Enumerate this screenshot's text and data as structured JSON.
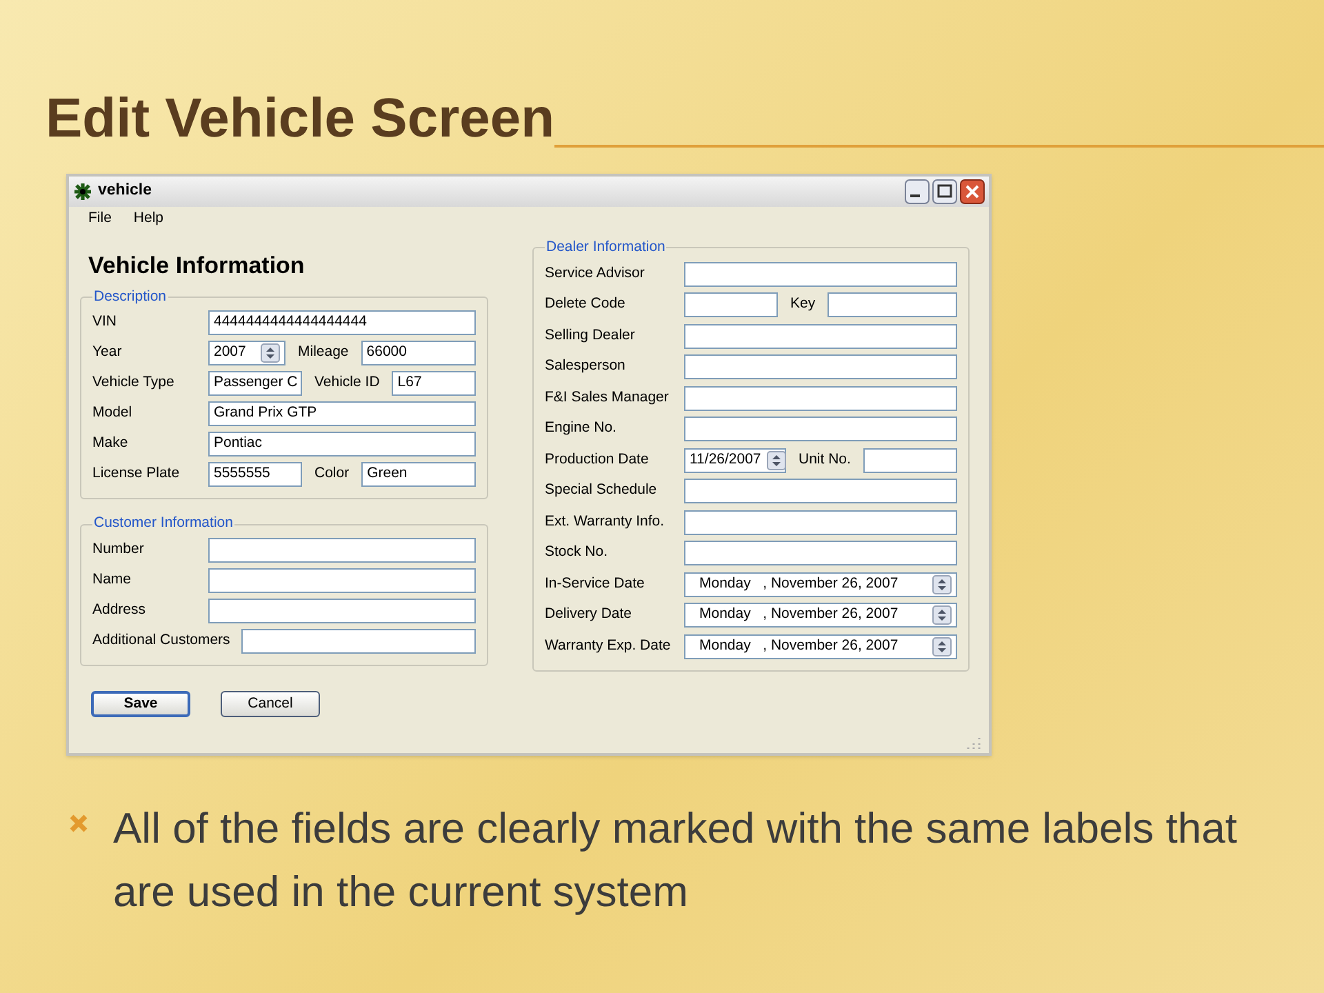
{
  "slide": {
    "title": "Edit Vehicle Screen",
    "bullets": [
      "All of the fields are clearly marked with the same labels that are used in the current system"
    ]
  },
  "window": {
    "title": "vehicle",
    "menu": [
      "File",
      "Help"
    ],
    "heading": "Vehicle Information",
    "description": {
      "legend": "Description",
      "rows": [
        {
          "label": "VIN",
          "inputs": [
            {
              "kind": "text",
              "value": "4444444444444444444"
            }
          ]
        },
        {
          "label": "Year",
          "inputs": [
            {
              "kind": "spinner",
              "value": "2007"
            },
            {
              "kind": "text",
              "label": "Mileage",
              "value": "66000"
            }
          ]
        },
        {
          "label": "Vehicle Type",
          "inputs": [
            {
              "kind": "text",
              "value": "Passenger C"
            },
            {
              "kind": "text",
              "label": "Vehicle ID",
              "value": "L67"
            }
          ]
        },
        {
          "label": "Model",
          "inputs": [
            {
              "kind": "text",
              "value": "Grand Prix GTP"
            }
          ]
        },
        {
          "label": "Make",
          "inputs": [
            {
              "kind": "text",
              "value": "Pontiac"
            }
          ]
        },
        {
          "label": "License Plate",
          "inputs": [
            {
              "kind": "text",
              "value": "5555555"
            },
            {
              "kind": "text",
              "label": "Color",
              "value": "Green"
            }
          ]
        }
      ]
    },
    "customer": {
      "legend": "Customer Information",
      "rows": [
        {
          "label": "Number",
          "inputs": [
            {
              "kind": "text"
            }
          ]
        },
        {
          "label": "Name",
          "inputs": [
            {
              "kind": "text"
            }
          ]
        },
        {
          "label": "Address",
          "inputs": [
            {
              "kind": "text"
            }
          ]
        },
        {
          "label": "Additional Customers",
          "inputs": [
            {
              "kind": "text"
            }
          ]
        }
      ]
    },
    "dealer": {
      "legend": "Dealer Information",
      "rows": [
        {
          "label": "Service Advisor",
          "inputs": [
            {
              "kind": "text"
            }
          ]
        },
        {
          "label": "Delete Code",
          "inputs": [
            {
              "kind": "text"
            },
            {
              "kind": "text",
              "label": "Key"
            }
          ]
        },
        {
          "label": "Selling Dealer",
          "inputs": [
            {
              "kind": "text"
            }
          ]
        },
        {
          "label": "Salesperson",
          "inputs": [
            {
              "kind": "text"
            }
          ]
        },
        {
          "label": "F&I Sales Manager",
          "inputs": [
            {
              "kind": "text"
            }
          ]
        },
        {
          "label": "Engine No.",
          "inputs": [
            {
              "kind": "text"
            }
          ]
        },
        {
          "label": "Production Date",
          "inputs": [
            {
              "kind": "spinner",
              "value": "11/26/2007"
            },
            {
              "kind": "text",
              "label": "Unit No."
            }
          ]
        },
        {
          "label": "Special Schedule",
          "inputs": [
            {
              "kind": "text"
            }
          ]
        },
        {
          "label": "Ext. Warranty Info.",
          "inputs": [
            {
              "kind": "text"
            }
          ]
        },
        {
          "label": "Stock No.",
          "inputs": [
            {
              "kind": "text"
            }
          ]
        },
        {
          "label": "In-Service Date",
          "inputs": [
            {
              "kind": "date",
              "value": "Monday   , November 26, 2007"
            }
          ]
        },
        {
          "label": "Delivery Date",
          "inputs": [
            {
              "kind": "date",
              "value": "Monday   , November 26, 2007"
            }
          ]
        },
        {
          "label": "Warranty Exp. Date",
          "inputs": [
            {
              "kind": "date",
              "value": "Monday   , November 26, 2007"
            }
          ]
        }
      ]
    },
    "buttons": [
      {
        "label": "Save",
        "default": true
      },
      {
        "label": "Cancel",
        "default": false
      }
    ]
  }
}
